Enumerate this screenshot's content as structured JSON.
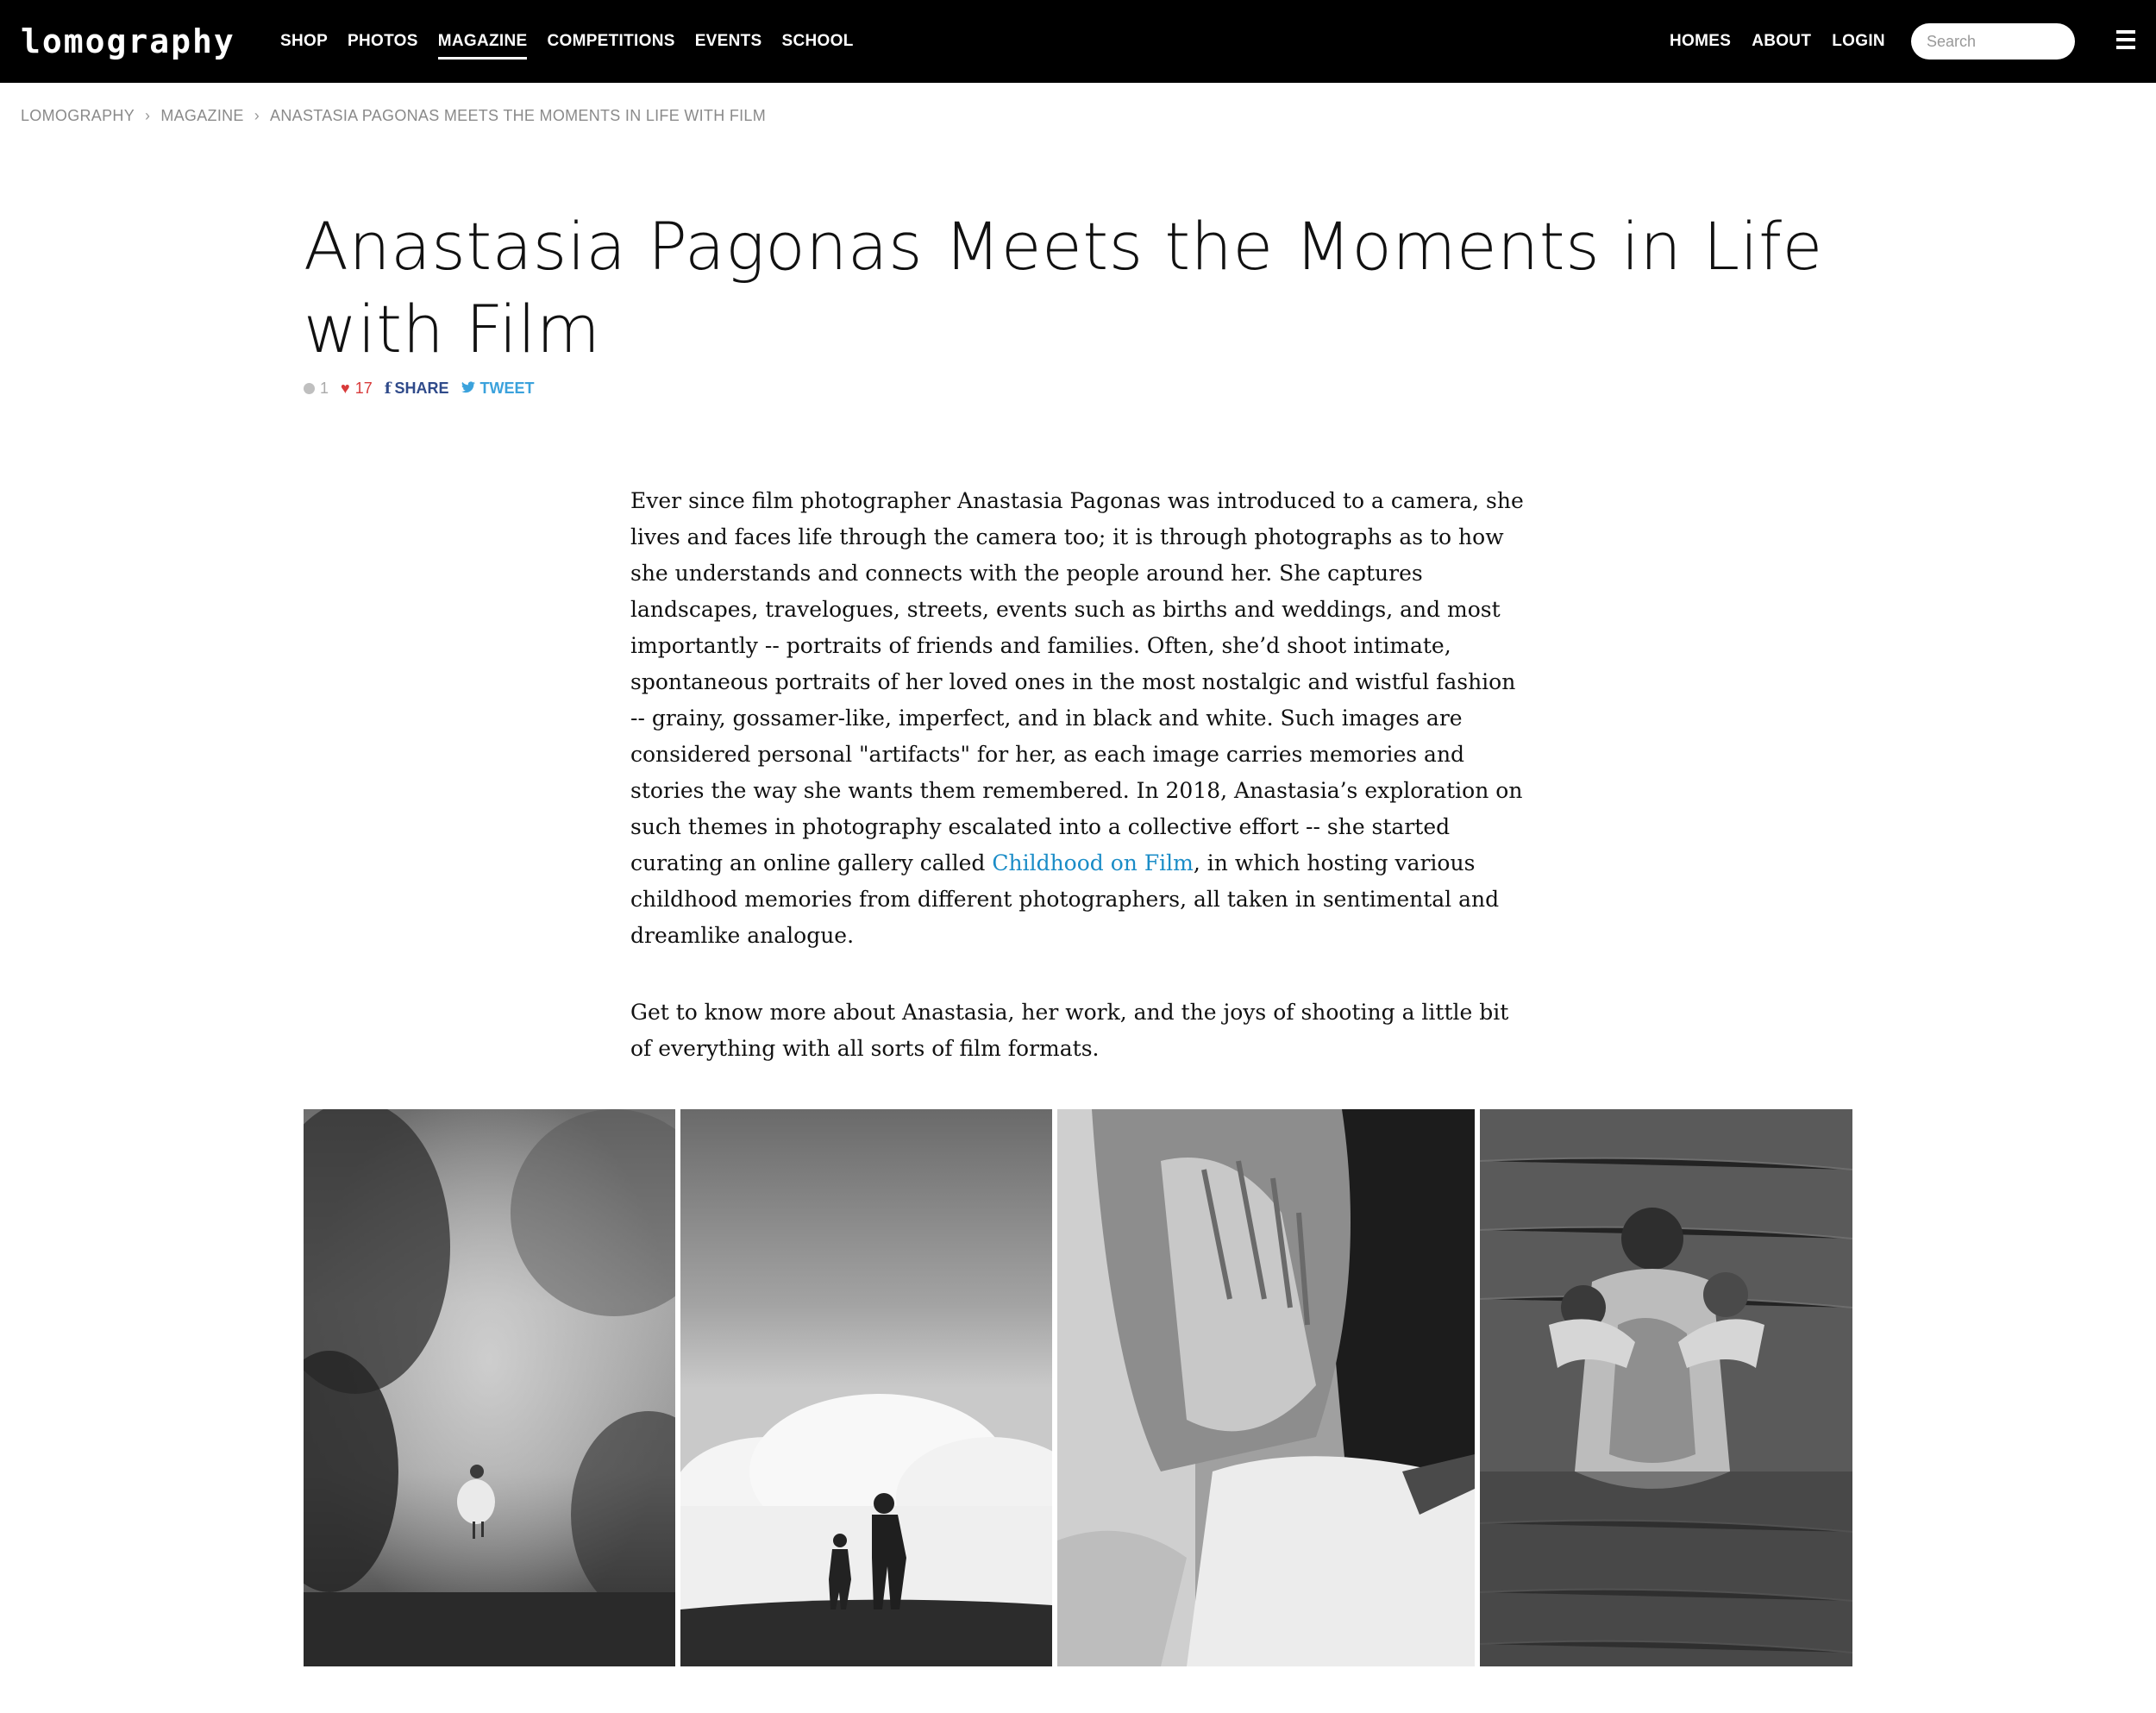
{
  "nav": {
    "logo": "lomography",
    "left_items": [
      "SHOP",
      "PHOTOS",
      "MAGAZINE",
      "COMPETITIONS",
      "EVENTS",
      "SCHOOL"
    ],
    "active": "MAGAZINE",
    "right_items": [
      "HOMES",
      "ABOUT",
      "LOGIN"
    ],
    "search_placeholder": "Search",
    "menu_icon": "hamburger-icon"
  },
  "breadcrumb": [
    "LOMOGRAPHY",
    "MAGAZINE",
    "ANASTASIA PAGONAS MEETS THE MOMENTS IN LIFE WITH FILM"
  ],
  "article": {
    "title": "Anastasia Pagonas Meets the Moments in Life with Film",
    "comments": "1",
    "likes": "17",
    "share_label": "SHARE",
    "tweet_label": "TWEET",
    "paragraph1_before_link": "Ever since film photographer Anastasia Pagonas was introduced to a camera, she lives and faces life through the camera too; it is through photographs as to how she understands and connects with the people around her. She captures landscapes, travelogues, streets, events such as births and weddings, and most importantly -- portraits of friends and families. Often, she’d shoot intimate, spontaneous portraits of her loved ones in the most nostalgic and wistful fashion -- grainy, gossamer-like, imperfect, and in black and white. Such images are considered personal \"artifacts\" for her, as each image carries memories and stories the way she wants them remembered. In 2018, Anastasia’s exploration on such themes in photography escalated into a collective effort -- she started curating an online gallery called ",
    "paragraph1_link": "Childhood on Film",
    "paragraph1_after_link": ", in which hosting various childhood memories from different photographers, all taken in sentimental and dreamlike analogue.",
    "paragraph2": "Get to know more about Anastasia, her work, and the joys of shooting a little bit of everything with all sorts of film formats."
  },
  "colors": {
    "nav_bg": "#000000",
    "link": "#1a8cc7",
    "heart": "#d83a3a",
    "facebook": "#2f4a8a",
    "twitter": "#3ba2dc"
  }
}
